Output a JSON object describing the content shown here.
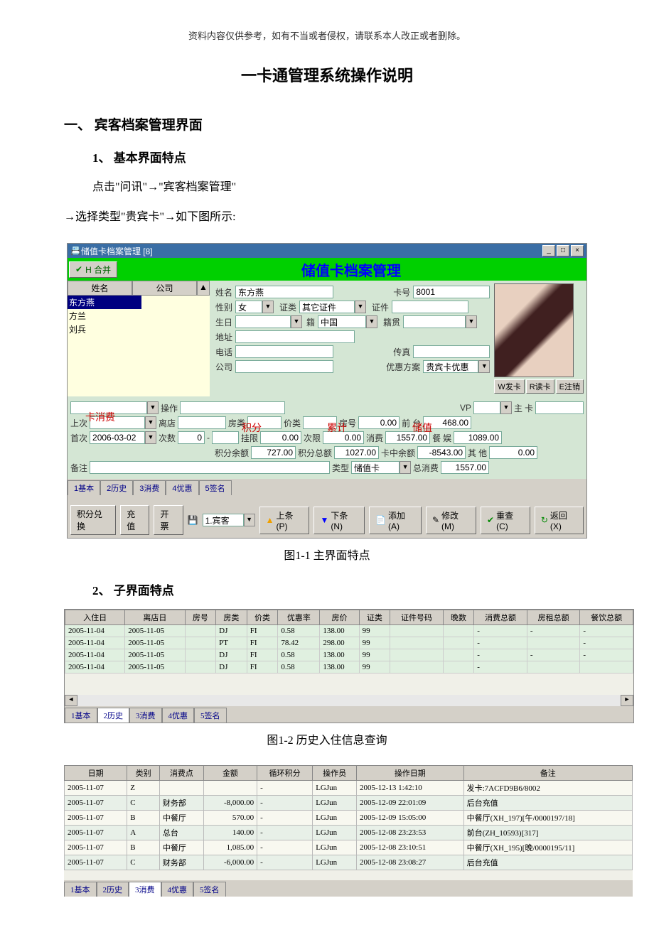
{
  "doc": {
    "header_note": "资料内容仅供参考，如有不当或者侵权，请联系本人改正或者删除。",
    "title": "一卡通管理系统操作说明",
    "sec1": "一、 宾客档案管理界面",
    "sec1_1": "1、 基本界面特点",
    "p1": "点击\"问讯\"→\"宾客档案管理\"",
    "p2": "→选择类型\"贵宾卡\"→如下图所示:",
    "cap1_1": "图1-1  主界面特点",
    "sec1_2": "2、 子界面特点",
    "cap1_2": "图1-2    历史入住信息查询"
  },
  "app": {
    "title": "储值卡档案管理 [8]",
    "merge_btn": "H 合并",
    "banner": "储值卡档案管理",
    "list": {
      "h1": "姓名",
      "h2": "公司",
      "rows": [
        {
          "n": "东方燕"
        },
        {
          "n": "方兰"
        },
        {
          "n": "刘兵"
        }
      ]
    },
    "form": {
      "name_l": "姓名",
      "name_v": "东方燕",
      "card_l": "卡号",
      "card_v": "8001",
      "sex_l": "性别",
      "sex_v": "女",
      "idtype_l": "证类",
      "idtype_v": "其它证件",
      "id_l": "证件",
      "birth_l": "生日",
      "nat_l": "籍",
      "nat_v": "中国",
      "natplace_l": "籍贯",
      "addr_l": "地址",
      "tel_l": "电话",
      "fax_l": "传真",
      "co_l": "公司",
      "plan_l": "优惠方案",
      "plan_v": "贵宾卡优惠",
      "btn_issue": "W发卡",
      "btn_read": "R读卡",
      "btn_cancel": "E注销"
    },
    "mid": {
      "op_l": "操作",
      "vp_l": "VP",
      "main_l": "主",
      "card_l": "卡",
      "last_l": "上次",
      "leave_l": "离店",
      "rtype_l": "房类",
      "ptype_l": "价类",
      "room_l": "房号",
      "room_v": "0.00",
      "front_l": "前",
      "desk_l": "台",
      "front_v": "468.00",
      "first_l": "首次",
      "first_v": "2006-03-02",
      "times_l": "次数",
      "times_v": "0",
      "limit_l": "挂限",
      "limit_v": "0.00",
      "nlimit_l": "次限",
      "nlimit_v": "0.00",
      "cons_l": "消费",
      "cons_v": "1557.00",
      "ent_l": "餐",
      "yu_l": "娱",
      "ent_v": "1089.00",
      "pbal_l": "积分余额",
      "pbal_v": "727.00",
      "ptot_l": "积分总额",
      "ptot_v": "1027.00",
      "cbal_l": "卡中余额",
      "cbal_v": "-8543.00",
      "other_l": "其",
      "oth2_l": "他",
      "other_v": "0.00",
      "remark_l": "备注",
      "type_l": "类型",
      "type_v": "储值卡",
      "totcons_l": "总消费",
      "totcons_v": "1557.00"
    },
    "tabs": [
      "1基本",
      "2历史",
      "3消费",
      "4优惠",
      "5签名"
    ],
    "bottom": {
      "redeem": "积分兑换",
      "recharge": "充值",
      "invoice": "开票",
      "combo": "1.宾客",
      "prev": "上条(P)",
      "next": "下条(N)",
      "add": "添加(A)",
      "edit": "修改(M)",
      "reset": "重查(C)",
      "back": "返回(X)"
    }
  },
  "annot": {
    "kxf": "卡消费",
    "jf": "积分",
    "lj": "累计",
    "cz": "储值"
  },
  "history": {
    "cols": [
      "入住日",
      "离店日",
      "房号",
      "房类",
      "价类",
      "优惠率",
      "房价",
      "证类",
      "证件号码",
      "晚数",
      "消费总额",
      "房租总额",
      "餐饮总额"
    ],
    "rows": [
      [
        "2005-11-04",
        "2005-11-05",
        "",
        "DJ",
        "FI",
        "0.58",
        "138.00",
        "99",
        "",
        "",
        "-",
        "-",
        "-"
      ],
      [
        "2005-11-04",
        "2005-11-05",
        "",
        "PT",
        "FI",
        "78.42",
        "298.00",
        "99",
        "",
        "",
        "-",
        "",
        "-"
      ],
      [
        "2005-11-04",
        "2005-11-05",
        "",
        "DJ",
        "FI",
        "0.58",
        "138.00",
        "99",
        "",
        "",
        "-",
        "-",
        "-"
      ],
      [
        "2005-11-04",
        "2005-11-05",
        "",
        "DJ",
        "FI",
        "0.58",
        "138.00",
        "99",
        "",
        "",
        "-",
        "",
        ""
      ]
    ],
    "tabs": [
      "1基本",
      "2历史",
      "3消费",
      "4优惠",
      "5签名"
    ]
  },
  "consume": {
    "cols": [
      "日期",
      "类别",
      "消费点",
      "金额",
      "循环积分",
      "操作员",
      "操作日期",
      "备注"
    ],
    "rows": [
      [
        "2005-11-07",
        "Z",
        "",
        "",
        "-",
        "LGJun",
        "2005-12-13 1:42:10",
        "发卡:7ACFD9B6/8002"
      ],
      [
        "2005-11-07",
        "C",
        "财务部",
        "-8,000.00",
        "-",
        "LGJun",
        "2005-12-09 22:01:09",
        "后台充值"
      ],
      [
        "2005-11-07",
        "B",
        "中餐厅",
        "570.00",
        "-",
        "LGJun",
        "2005-12-09 15:05:00",
        "中餐厅(XH_197)[午/0000197/18]"
      ],
      [
        "2005-11-07",
        "A",
        "总台",
        "140.00",
        "-",
        "LGJun",
        "2005-12-08 23:23:53",
        "前台(ZH_10593)[317]"
      ],
      [
        "2005-11-07",
        "B",
        "中餐厅",
        "1,085.00",
        "-",
        "LGJun",
        "2005-12-08 23:10:51",
        "中餐厅(XH_195)[晚/0000195/11]"
      ],
      [
        "2005-11-07",
        "C",
        "财务部",
        "-6,000.00",
        "-",
        "LGJun",
        "2005-12-08 23:08:27",
        "后台充值"
      ]
    ],
    "tabs": [
      "1基本",
      "2历史",
      "3消费",
      "4优惠",
      "5签名"
    ]
  }
}
